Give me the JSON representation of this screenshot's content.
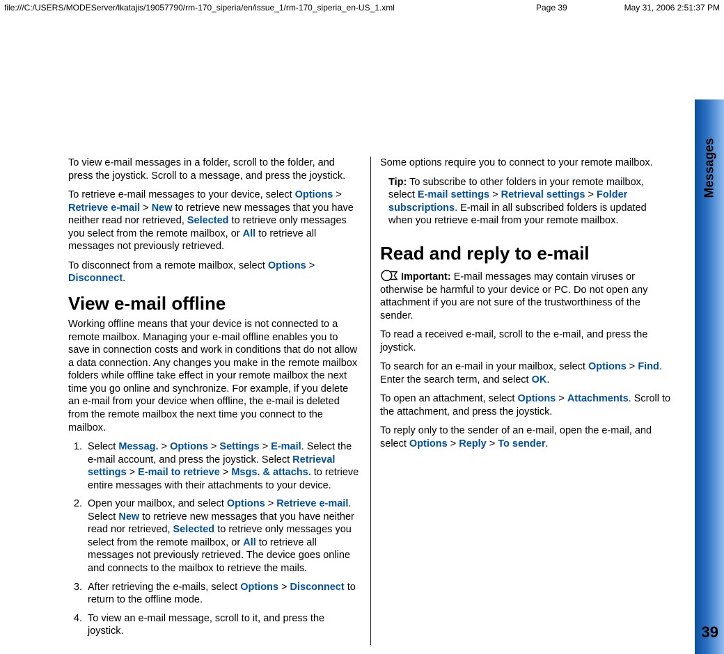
{
  "header": {
    "path": "file:///C:/USERS/MODEServer/lkatajis/19057790/rm-170_siperia/en/issue_1/rm-170_siperia_en-US_1.xml",
    "page": "Page 39",
    "timestamp": "May 31, 2006 2:51:37 PM"
  },
  "sidebar": {
    "label": "Messages",
    "pagenum": "39"
  },
  "ui": {
    "options": "Options",
    "retrieve_email": "Retrieve e-mail",
    "new": "New",
    "selected": "Selected",
    "all": "All",
    "disconnect": "Disconnect",
    "messag": "Messag.",
    "settings": "Settings",
    "email": "E-mail",
    "retrieval_settings": "Retrieval settings",
    "email_to_retrieve": "E-mail to retrieve",
    "msgs_attachs": "Msgs. & attachs.",
    "email_settings": "E-mail settings",
    "folder_subscriptions": "Folder subscriptions",
    "find": "Find",
    "ok": "OK",
    "attachments": "Attachments",
    "reply": "Reply",
    "to_sender": "To sender"
  },
  "txt": {
    "p1": "To view e-mail messages in a folder, scroll to the folder, and press the joystick. Scroll to a message, and press the joystick.",
    "p2a": "To retrieve e-mail messages to your device, select ",
    "p2b": " to retrieve new messages that you have neither read nor retrieved, ",
    "p2c": " to retrieve only messages you select from the remote mailbox, or ",
    "p2d": " to retrieve all messages not previously retrieved.",
    "p3a": "To disconnect from a remote mailbox, select ",
    "h1": "View e-mail offline",
    "p4": "Working offline means that your device is not connected to a remote mailbox. Managing your e-mail offline enables you to save in connection costs and work in conditions that do not allow a data connection. Any changes you make in the remote mailbox folders while offline take effect in your remote mailbox the next time you go online and synchronize. For example, if you delete an e-mail from your device when offline, the e-mail is deleted from the remote mailbox the next time you connect to the mailbox.",
    "li1a": "Select ",
    "li1b": ". Select the e-mail account, and press the joystick. Select ",
    "li1c": " to retrieve entire messages with their attachments to your device.",
    "li2a": "Open your mailbox, and select ",
    "li2b": ". Select ",
    "li2c": " to retrieve new messages that you have neither read nor retrieved, ",
    "li2d": " to retrieve only messages you select from the remote mailbox, or ",
    "li2e": " to retrieve all messages not previously retrieved. The device goes online and connects to the mailbox to retrieve the mails.",
    "li3a": "After retrieving the e-mails, select ",
    "li3b": " to return to the offline mode.",
    "li4": "To view an e-mail message, scroll to it, and press the joystick.",
    "p5": "Some options require you to connect to your remote mailbox.",
    "tip_label": "Tip:",
    "tip_a": " To subscribe to other folders in your remote mailbox, select ",
    "tip_b": ". E-mail in all subscribed folders is updated when you retrieve e-mail from your remote mailbox.",
    "h2": "Read and reply to e-mail",
    "imp_label": "Important:",
    "imp_txt": "  E-mail messages may contain viruses or otherwise be harmful to your device or PC. Do not open any attachment if you are not sure of the trustworthiness of the sender.",
    "p6": "To read a received e-mail, scroll to the e-mail, and press the joystick.",
    "p7a": "To search for an e-mail in your mailbox, select ",
    "p7b": ". Enter the search term, and select ",
    "p8a": "To open an attachment, select ",
    "p8b": ". Scroll to the attachment, and press the joystick.",
    "p9a": "To reply only to the sender of an e-mail, open the e-mail, and select ",
    "gt": " > ",
    "dot": "."
  }
}
